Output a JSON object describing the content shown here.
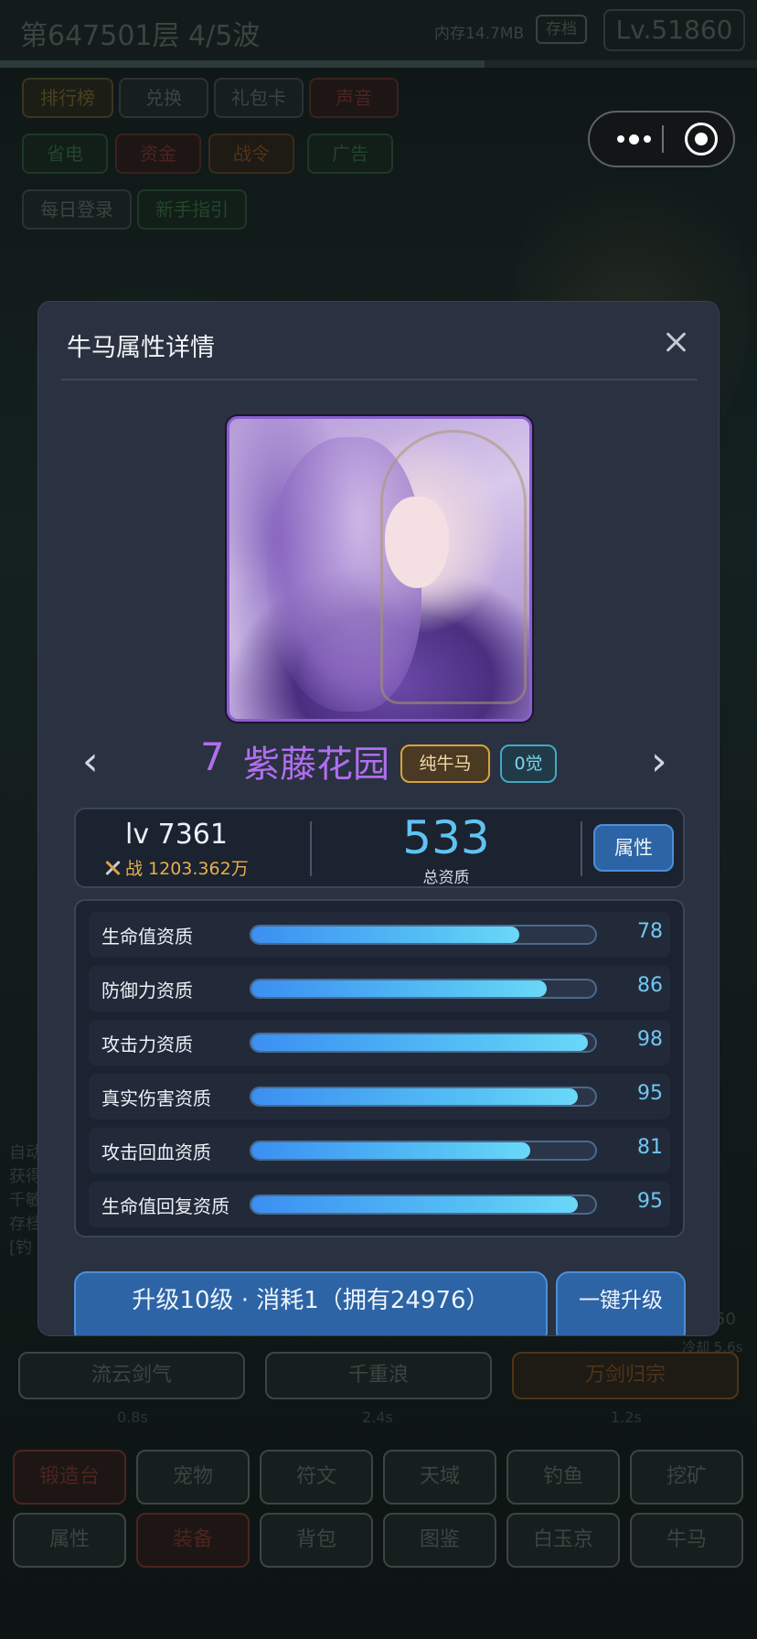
{
  "background": {
    "stage_title": "第647501层  4/5波",
    "memory_text": "内存14.7MB",
    "save_label": "存档",
    "level_badge": "Lv.51860",
    "menu_row1": [
      "排行榜",
      "兑换",
      "礼包卡",
      "声音"
    ],
    "menu_row2": [
      "省电",
      "资金",
      "战令",
      "广告"
    ],
    "menu_row3": [
      "每日登录",
      "新手指引"
    ],
    "log_lines": [
      "自动",
      "获得",
      "千敏",
      "存档",
      "[钓"
    ],
    "skills": [
      "流云剑气",
      "千重浪",
      "万剑归宗"
    ],
    "skill_times": [
      "0.8s",
      "2.4s",
      "1.2s"
    ],
    "side_values": [
      "50",
      "冷却 5.6s"
    ],
    "nav_row1": [
      "锻造台",
      "宠物",
      "符文",
      "天域",
      "钓鱼",
      "挖矿"
    ],
    "nav_row2": [
      "属性",
      "装备",
      "背包",
      "图鉴",
      "白玉京",
      "牛马"
    ]
  },
  "modal": {
    "title": "牛马属性详情",
    "hero": {
      "index": "7",
      "name": "紫藤花园",
      "tag_type": "纯牛马",
      "tag_awaken": "0觉",
      "name_color": "#b06ef0"
    },
    "prev_arrow": "‹",
    "next_arrow": "›",
    "level": "lv 7361",
    "power": "战 1203.362万",
    "total_quality": "533",
    "total_quality_label": "总资质",
    "attr_button": "属性",
    "qualities": [
      {
        "label": "生命值资质",
        "value": "78"
      },
      {
        "label": "防御力资质",
        "value": "86"
      },
      {
        "label": "攻击力资质",
        "value": "98"
      },
      {
        "label": "真实伤害资质",
        "value": "95"
      },
      {
        "label": "攻击回血资质",
        "value": "81"
      },
      {
        "label": "生命值回复资质",
        "value": "95"
      }
    ],
    "upgrade_button": "升级10级 · 消耗1（拥有24976）",
    "oneclick_button": "一键升级"
  },
  "colors": {
    "accent_blue": "#5fc3f3",
    "button_blue": "#2c64a6",
    "gold": "#e6b04a",
    "purple": "#b06ef0"
  }
}
